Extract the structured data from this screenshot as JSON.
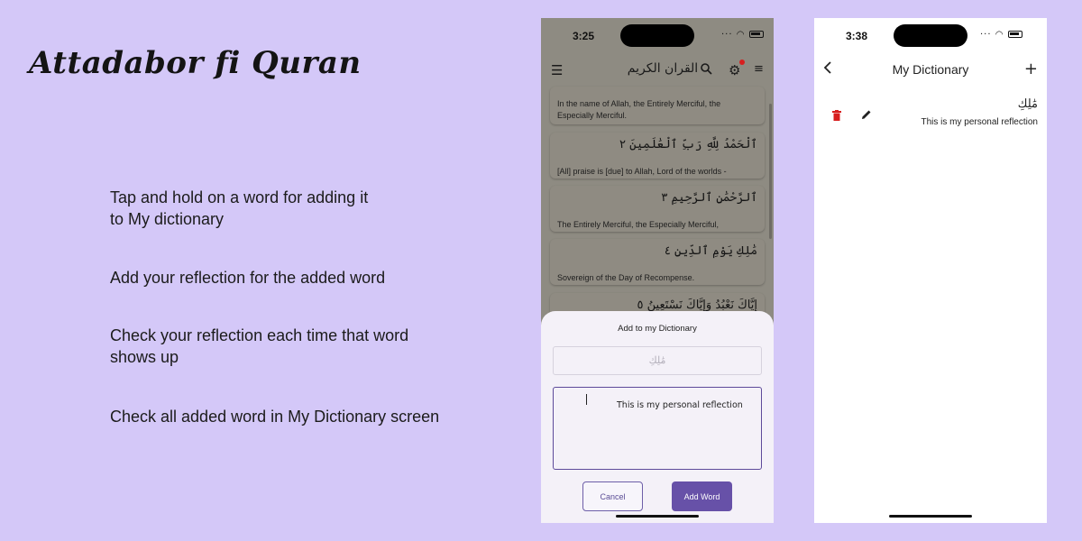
{
  "app_title": "Attadabor fi Quran",
  "features": [
    "Tap and hold on a word for adding it\nto My dictionary",
    "Add your reflection for the added word",
    "Check your reflection each time that word\nshows up",
    "Check all added word in My Dictionary screen"
  ],
  "phone1": {
    "time": "3:25",
    "appbar_title": "القران الكريم",
    "icons": [
      "menu-icon",
      "search-icon",
      "gear-icon",
      "list-icon"
    ],
    "verses": [
      {
        "arabic": "",
        "translation": "In the name of Allah, the Entirely Merciful, the Especially Merciful."
      },
      {
        "arabic": "ٱلْحَمْدُ لِلَّهِ رَبِّ ٱلْعَٰلَمِينَ ٢",
        "translation": "[All] praise is [due] to Allah, Lord of the worlds -"
      },
      {
        "arabic": "ٱلرَّحْمَٰنِ ٱلرَّحِيمِ ٣",
        "translation": "The Entirely Merciful, the Especially Merciful,"
      },
      {
        "arabic": "مَٰلِكِ يَوْمِ ٱلدِّينِ ٤",
        "translation": "Sovereign of the Day of Recompense."
      },
      {
        "arabic": "إِيَّاكَ نَعْبُدُ وَإِيَّاكَ نَسْتَعِينُ ٥",
        "translation": ""
      }
    ],
    "sheet": {
      "title": "Add to my Dictionary",
      "word_value": "مَٰلِكِ",
      "reflection_value": "This is my personal reflection",
      "cancel_label": "Cancel",
      "add_label": "Add Word"
    }
  },
  "phone2": {
    "time": "3:38",
    "title": "My Dictionary",
    "entries": [
      {
        "word": "مَٰلِكِ",
        "reflection": "This is my personal reflection"
      }
    ]
  },
  "colors": {
    "background": "#d4c8f8",
    "accent": "#6751a8",
    "delete": "#d71f1f"
  }
}
